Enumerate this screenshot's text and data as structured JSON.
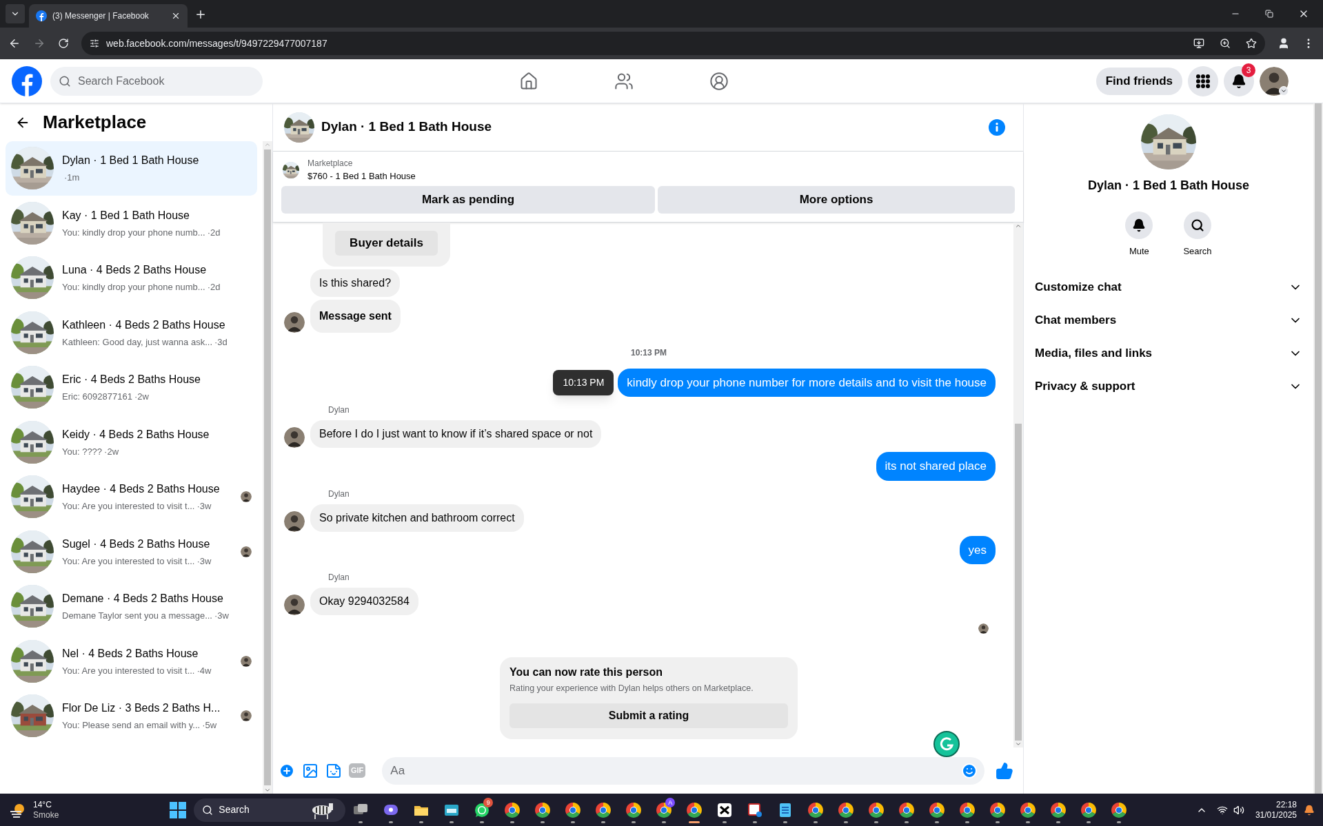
{
  "browser": {
    "tab_title": "(3) Messenger | Facebook",
    "url": "web.facebook.com/messages/t/9497229477007187"
  },
  "top_nav": {
    "search_placeholder": "Search Facebook",
    "find_friends": "Find friends",
    "notification_count": "3"
  },
  "sidebar": {
    "title": "Marketplace",
    "conversations": [
      {
        "title": "Dylan · 1 Bed 1 Bath House",
        "time": "·1m",
        "selected": true,
        "seen": false
      },
      {
        "title": "Kay · 1 Bed 1 Bath House",
        "preview": "You: kindly drop your phone numb...",
        "time": "·2d",
        "selected": false,
        "seen": false
      },
      {
        "title": "Luna · 4 Beds 2 Baths House",
        "preview": "You: kindly drop your phone numb...",
        "time": "·2d",
        "selected": false,
        "seen": false
      },
      {
        "title": "Kathleen · 4 Beds 2 Baths House",
        "preview": "Kathleen: Good day, just wanna ask...",
        "time": "·3d",
        "selected": false,
        "seen": false
      },
      {
        "title": "Eric · 4 Beds 2 Baths House",
        "preview": "Eric: 6092877161",
        "time": "·2w",
        "selected": false,
        "seen": false
      },
      {
        "title": "Keidy · 4 Beds 2 Baths House",
        "preview": "You: ????",
        "time": "·2w",
        "selected": false,
        "seen": false
      },
      {
        "title": "Haydee · 4 Beds 2 Baths House",
        "preview": "You: Are you interested to visit t...",
        "time": "·3w",
        "selected": false,
        "seen": true
      },
      {
        "title": "Sugel · 4 Beds 2 Baths House",
        "preview": "You: Are you interested to visit t...",
        "time": "·3w",
        "selected": false,
        "seen": true
      },
      {
        "title": "Demane · 4 Beds 2 Baths House",
        "preview": "Demane Taylor sent you a message...",
        "time": "·3w",
        "selected": false,
        "seen": false
      },
      {
        "title": "Nel · 4 Beds 2 Baths House",
        "preview": "You: Are you interested to visit t...",
        "time": "·4w",
        "selected": false,
        "seen": true
      },
      {
        "title": "Flor De Liz · 3 Beds 2 Baths H...",
        "preview": "You: Please send an email with y...",
        "time": "·5w",
        "selected": false,
        "seen": true
      }
    ]
  },
  "chat": {
    "title": "Dylan · 1 Bed 1 Bath House",
    "listing_label": "Marketplace",
    "listing": "$760 - 1 Bed 1 Bath House",
    "actions": [
      "Mark as pending",
      "More options"
    ],
    "messages": [
      {
        "kind": "buyer_card",
        "button": "Buyer details"
      },
      {
        "kind": "incoming",
        "text": "Is this shared?",
        "bold": false,
        "avatar": false
      },
      {
        "kind": "incoming",
        "text": "Message sent",
        "bold": true,
        "avatar": true
      },
      {
        "kind": "timestamp",
        "text": "10:13 PM"
      },
      {
        "kind": "outgoing",
        "text": "kindly drop your phone number for more details and to visit the house",
        "tooltip": "10:13 PM"
      },
      {
        "kind": "sender",
        "text": "Dylan"
      },
      {
        "kind": "incoming",
        "text": "Before I do I just want to know if it’s shared space or not",
        "bold": false,
        "avatar": true
      },
      {
        "kind": "outgoing",
        "text": "its not shared place"
      },
      {
        "kind": "sender",
        "text": "Dylan"
      },
      {
        "kind": "incoming",
        "text": "So private kitchen and bathroom correct",
        "bold": false,
        "avatar": true
      },
      {
        "kind": "outgoing",
        "text": "yes"
      },
      {
        "kind": "sender",
        "text": "Dylan"
      },
      {
        "kind": "incoming",
        "text": "Okay 9294032584",
        "bold": false,
        "avatar": true
      },
      {
        "kind": "seen"
      }
    ],
    "rating": {
      "title": "You can now rate this person",
      "text": "Rating your experience with Dylan helps others on Marketplace.",
      "button": "Submit a rating"
    },
    "composer": {
      "gif_label": "GIF",
      "placeholder": "Aa"
    }
  },
  "details": {
    "name": "Dylan · 1 Bed 1 Bath House",
    "actions": [
      {
        "kind": "bell",
        "label": "Mute"
      },
      {
        "kind": "search",
        "label": "Search"
      }
    ],
    "sections": [
      {
        "label": "Customize chat",
        "expanded": false
      },
      {
        "label": "Chat members",
        "expanded": false
      },
      {
        "label": "Media, files and links",
        "expanded": false
      },
      {
        "label": "Privacy & support",
        "expanded": false
      }
    ]
  },
  "taskbar": {
    "temperature": "14°C",
    "weather": "Smoke",
    "search": "Search",
    "apps": [
      {
        "kind": "taskview"
      },
      {
        "kind": "meet"
      },
      {
        "kind": "folder"
      },
      {
        "kind": "keyboard"
      },
      {
        "kind": "whatsapp",
        "badge": "9"
      },
      {
        "kind": "browser",
        "active": false
      },
      {
        "kind": "browser",
        "active": false
      },
      {
        "kind": "browser",
        "active": false
      },
      {
        "kind": "browser",
        "active": false
      },
      {
        "kind": "browser",
        "active": false
      },
      {
        "kind": "browser",
        "badge": "A",
        "active": false
      },
      {
        "kind": "browser",
        "active": true
      },
      {
        "kind": "cut"
      },
      {
        "kind": "snip"
      },
      {
        "kind": "notepad"
      },
      {
        "kind": "browser",
        "active": false
      },
      {
        "kind": "browser",
        "active": false
      },
      {
        "kind": "browser",
        "active": false
      },
      {
        "kind": "browser",
        "active": false
      },
      {
        "kind": "browser",
        "active": false
      },
      {
        "kind": "browser",
        "active": false
      },
      {
        "kind": "browser",
        "active": false
      },
      {
        "kind": "browser",
        "active": false
      },
      {
        "kind": "browser",
        "active": false
      },
      {
        "kind": "browser",
        "active": false
      },
      {
        "kind": "browser",
        "active": false
      }
    ],
    "time": "22:18",
    "date": "31/01/2025"
  }
}
